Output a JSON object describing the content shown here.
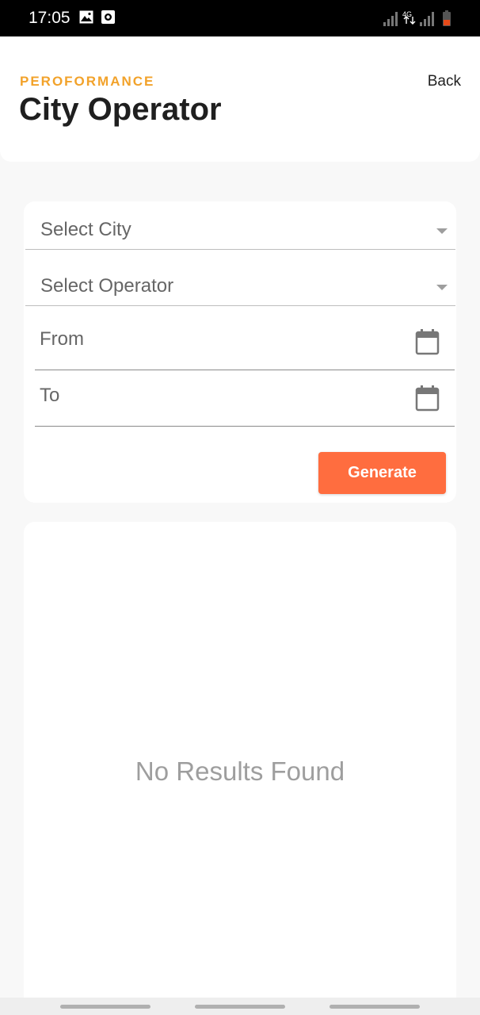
{
  "status_bar": {
    "time": "17:05",
    "icons": [
      "gallery-icon",
      "record-icon",
      "signal-icon",
      "4g-icon",
      "signal-icon",
      "battery-icon"
    ],
    "network_label": "4G"
  },
  "header": {
    "kicker": "PEROFORMANCE",
    "title": "City Operator",
    "back_label": "Back"
  },
  "form": {
    "city_select": {
      "placeholder": "Select City"
    },
    "operator_select": {
      "placeholder": "Select Operator"
    },
    "from_field": {
      "label": "From",
      "value": ""
    },
    "to_field": {
      "label": "To",
      "value": ""
    },
    "generate_label": "Generate"
  },
  "results": {
    "empty_message": "No Results Found"
  },
  "colors": {
    "accent_orange": "#f2a22a",
    "button": "#ff6d3f",
    "background": "#f8f8f8"
  }
}
